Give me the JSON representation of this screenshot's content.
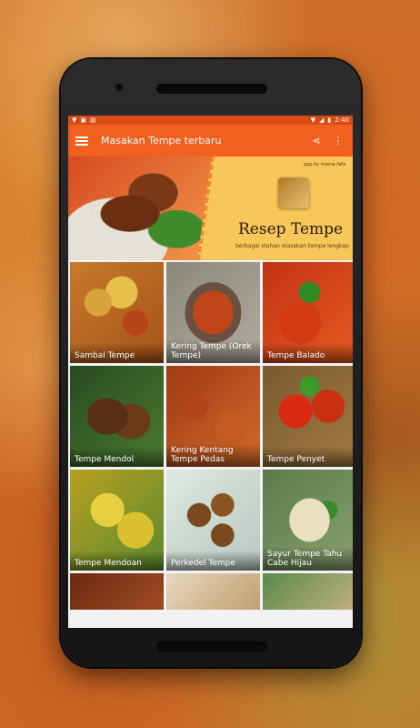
{
  "status_bar": {
    "time": "2:40"
  },
  "app_bar": {
    "title": "Masakan Tempe terbaru",
    "icons": [
      "menu-icon",
      "share-icon",
      "more-vert-icon"
    ]
  },
  "banner": {
    "credit": "app by mama fafa",
    "title": "Resep Tempe",
    "subtitle": "berbagai olahan masakan tempe lengkap"
  },
  "recipes": [
    {
      "label": "Sambal Tempe"
    },
    {
      "label": "Kering Tempe (Orek Tempe)"
    },
    {
      "label": "Tempe Balado"
    },
    {
      "label": "Tempe Mendol"
    },
    {
      "label": "Kering Kentang Tempe Pedas"
    },
    {
      "label": "Tempe Penyet"
    },
    {
      "label": "Tempe Mendoan"
    },
    {
      "label": "Perkedel Tempe"
    },
    {
      "label": "Sayur Tempe Tahu Cabe Hijau"
    }
  ],
  "colors": {
    "app_bar": "#f2601f",
    "status_bar": "#d94a14",
    "banner_bg": "#f8c75a"
  }
}
